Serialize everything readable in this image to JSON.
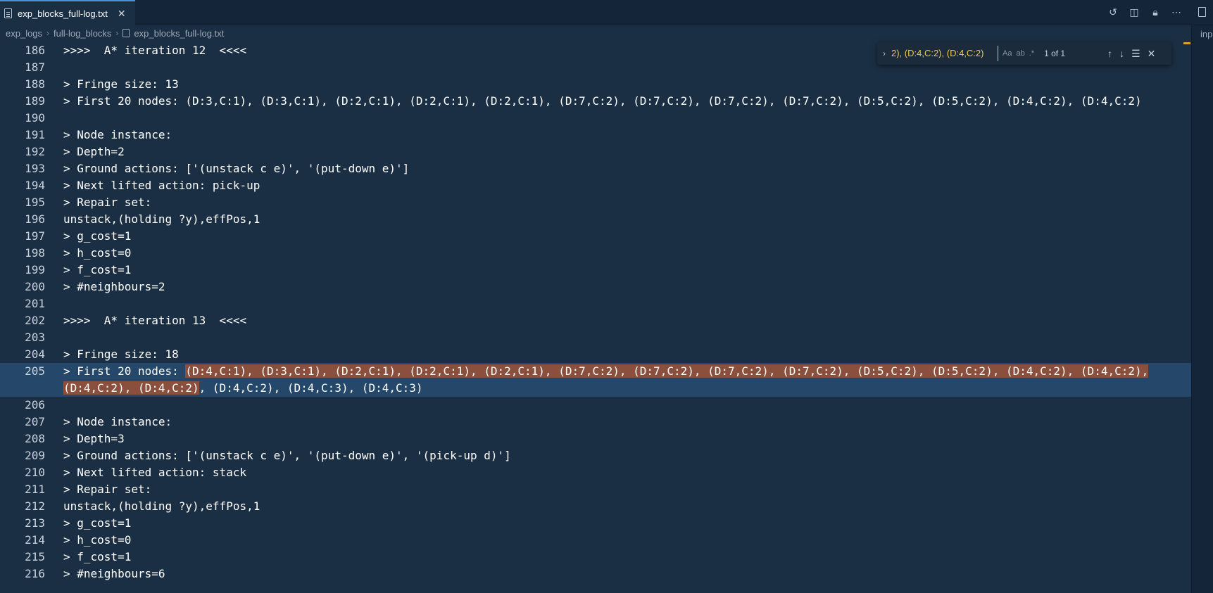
{
  "tab": {
    "label": "exp_blocks_full-log.txt"
  },
  "side_panel": {
    "label": "inp"
  },
  "breadcrumb": {
    "items": [
      "exp_logs",
      "full-log_blocks",
      "exp_blocks_full-log.txt"
    ]
  },
  "find": {
    "query": "2), (D:4,C:2), (D:4,C:2)",
    "opt_case": "Aa",
    "opt_word": "ab",
    "opt_regex": ".*",
    "count": "1 of 1"
  },
  "lines": [
    {
      "n": "186",
      "t": ">>>>  A* iteration 12  <<<<"
    },
    {
      "n": "187",
      "t": ""
    },
    {
      "n": "188",
      "t": "> Fringe size: 13"
    },
    {
      "n": "189",
      "t": "> First 20 nodes: (D:3,C:1), (D:3,C:1), (D:2,C:1), (D:2,C:1), (D:2,C:1), (D:7,C:2), (D:7,C:2), (D:7,C:2), (D:7,C:2), (D:5,C:2), (D:5,C:2), (D:4,C:2), (D:4,C:2)"
    },
    {
      "n": "190",
      "t": ""
    },
    {
      "n": "191",
      "t": "> Node instance:"
    },
    {
      "n": "192",
      "t": "> Depth=2"
    },
    {
      "n": "193",
      "t": "> Ground actions: ['(unstack c e)', '(put-down e)']"
    },
    {
      "n": "194",
      "t": "> Next lifted action: pick-up"
    },
    {
      "n": "195",
      "t": "> Repair set:"
    },
    {
      "n": "196",
      "t": "unstack,(holding ?y),effPos,1"
    },
    {
      "n": "197",
      "t": "> g_cost=1"
    },
    {
      "n": "198",
      "t": "> h_cost=0"
    },
    {
      "n": "199",
      "t": "> f_cost=1"
    },
    {
      "n": "200",
      "t": "> #neighbours=2"
    },
    {
      "n": "201",
      "t": ""
    },
    {
      "n": "202",
      "t": ">>>>  A* iteration 13  <<<<"
    },
    {
      "n": "203",
      "t": ""
    },
    {
      "n": "204",
      "t": "> Fringe size: 18"
    },
    {
      "n": "205",
      "p1": "> First 20 nodes: ",
      "h1": "(D:4,C:1), (D:3,C:1), (D:2,C:1), (D:2,C:1), (D:2,C:1), (D:7,C:2), (D:7,C:2), (D:7,C:2), (D:7,C:2), (D:5,C:2), (D:5,C:2), (D:4,C:2), (D:4,C:2),",
      "h2": "(D:4,C:2), (D:4,C:2)",
      "p2": ", (D:4,C:2), (D:4,C:3), (D:4,C:3)"
    },
    {
      "n": "206",
      "t": ""
    },
    {
      "n": "207",
      "t": "> Node instance:"
    },
    {
      "n": "208",
      "t": "> Depth=3"
    },
    {
      "n": "209",
      "t": "> Ground actions: ['(unstack c e)', '(put-down e)', '(pick-up d)']"
    },
    {
      "n": "210",
      "t": "> Next lifted action: stack"
    },
    {
      "n": "211",
      "t": "> Repair set:"
    },
    {
      "n": "212",
      "t": "unstack,(holding ?y),effPos,1"
    },
    {
      "n": "213",
      "t": "> g_cost=1"
    },
    {
      "n": "214",
      "t": "> h_cost=0"
    },
    {
      "n": "215",
      "t": "> f_cost=1"
    },
    {
      "n": "216",
      "t": "> #neighbours=6"
    }
  ]
}
